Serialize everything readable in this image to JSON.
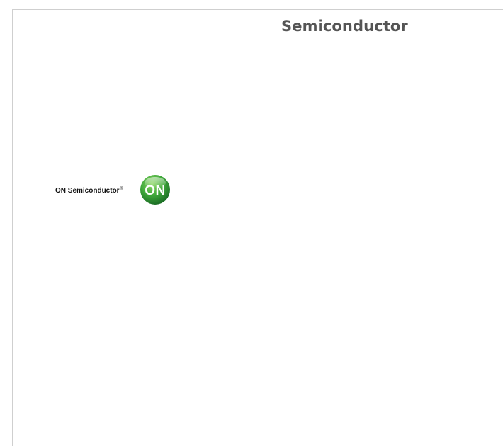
{
  "header": {
    "title": "Semiconductor"
  },
  "logo": {
    "wordmark": "ON Semiconductor",
    "registered_mark": "®",
    "mark_text": "ON",
    "colors": {
      "green_light": "#6dc24b",
      "green_dark": "#1f7a2a",
      "text": "#111111"
    }
  }
}
